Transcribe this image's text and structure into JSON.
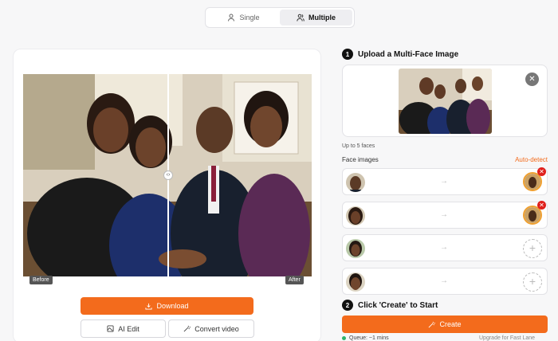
{
  "mode": {
    "single_label": "Single",
    "multiple_label": "Multiple",
    "active": "Multiple"
  },
  "preview": {
    "before_label": "Before",
    "after_label": "After"
  },
  "actions": {
    "download_label": "Download",
    "ai_edit_label": "AI Edit",
    "convert_label": "Convert video"
  },
  "step1": {
    "number": "1",
    "title": "Upload a Multi-Face Image"
  },
  "upload": {
    "hint": "Up to 5 faces"
  },
  "faces": {
    "header": "Face images",
    "auto_detect": "Auto-detect"
  },
  "step2": {
    "number": "2",
    "title": "Click 'Create' to Start"
  },
  "create": {
    "label": "Create",
    "queue": "Queue: ~1 mins",
    "upgrade": "Upgrade for Fast Lane"
  },
  "colors": {
    "accent": "#f36b1c",
    "dark": "#111111",
    "delete": "#e0201c"
  }
}
